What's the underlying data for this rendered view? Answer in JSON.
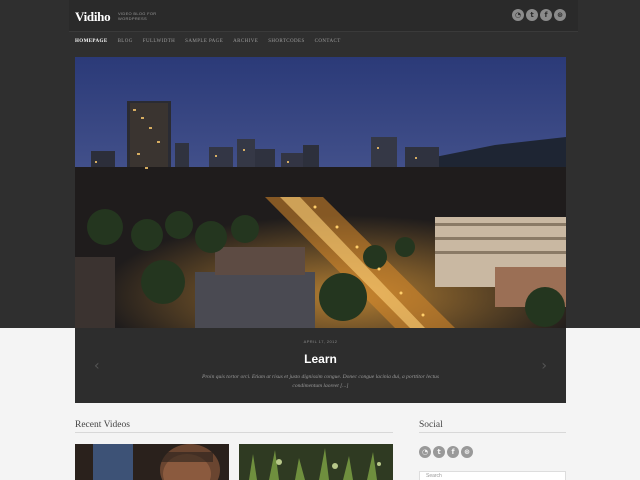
{
  "header": {
    "logo": "Vidiho",
    "tagline": "Video blog for WordPress",
    "social_icons": [
      "rss-icon",
      "twitter-icon",
      "facebook-icon",
      "dribbble-icon"
    ],
    "social_glyphs": [
      "◔",
      "t",
      "f",
      "⊛"
    ]
  },
  "nav": {
    "items": [
      "Homepage",
      "Blog",
      "Fullwidth",
      "Sample page",
      "Archive",
      "Shortcodes",
      "Contact"
    ],
    "active": "Homepage"
  },
  "hero": {
    "image": "night city skyline photo",
    "date": "April 17, 2012",
    "title": "Learn",
    "excerpt": "Proin quis tortor orci. Etiam at risus et justo dignissim congue. Donec congue lacinia dui, a porttitor lectus condimentum laoreet [...]",
    "prev_arrow": "‹",
    "next_arrow": "›"
  },
  "recent_videos": {
    "title": "Recent Videos"
  },
  "social": {
    "title": "Social",
    "social_icons": [
      "rss-icon",
      "twitter-icon",
      "facebook-icon",
      "dribbble-icon"
    ],
    "search_placeholder": "Search"
  },
  "colors": {
    "header_bg": "#2a2a2a",
    "page_bg": "#f4f4f4",
    "accent_text": "#ffffff"
  }
}
